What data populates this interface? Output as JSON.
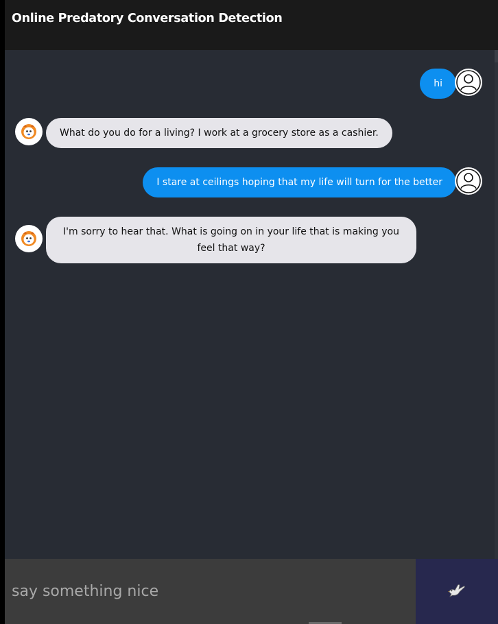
{
  "header": {
    "title": "Online Predatory Conversation Detection"
  },
  "messages": [
    {
      "sender": "user",
      "text": "hi",
      "avatar_icon": "user-profile-icon"
    },
    {
      "sender": "bot",
      "text": "What do you do for a living? I work at a grocery store as a cashier.",
      "avatar_icon": "bot-avatar-icon"
    },
    {
      "sender": "user",
      "text": "I stare at ceilings hoping that my life will turn for the better",
      "avatar_icon": "user-profile-icon"
    },
    {
      "sender": "bot",
      "text": "I'm sorry to hear that. What is going on in your life that is making you feel that way?",
      "avatar_icon": "bot-avatar-icon"
    }
  ],
  "composer": {
    "placeholder": "say something nice",
    "value": "",
    "send_icon": "dove-icon"
  },
  "colors": {
    "header_bg": "#1a1a1a",
    "chat_bg": "#282c34",
    "user_bubble": "#0d8ff0",
    "bot_bubble": "#e6e5ea",
    "input_bg": "#3c3c3c",
    "send_bg": "#27284e"
  }
}
